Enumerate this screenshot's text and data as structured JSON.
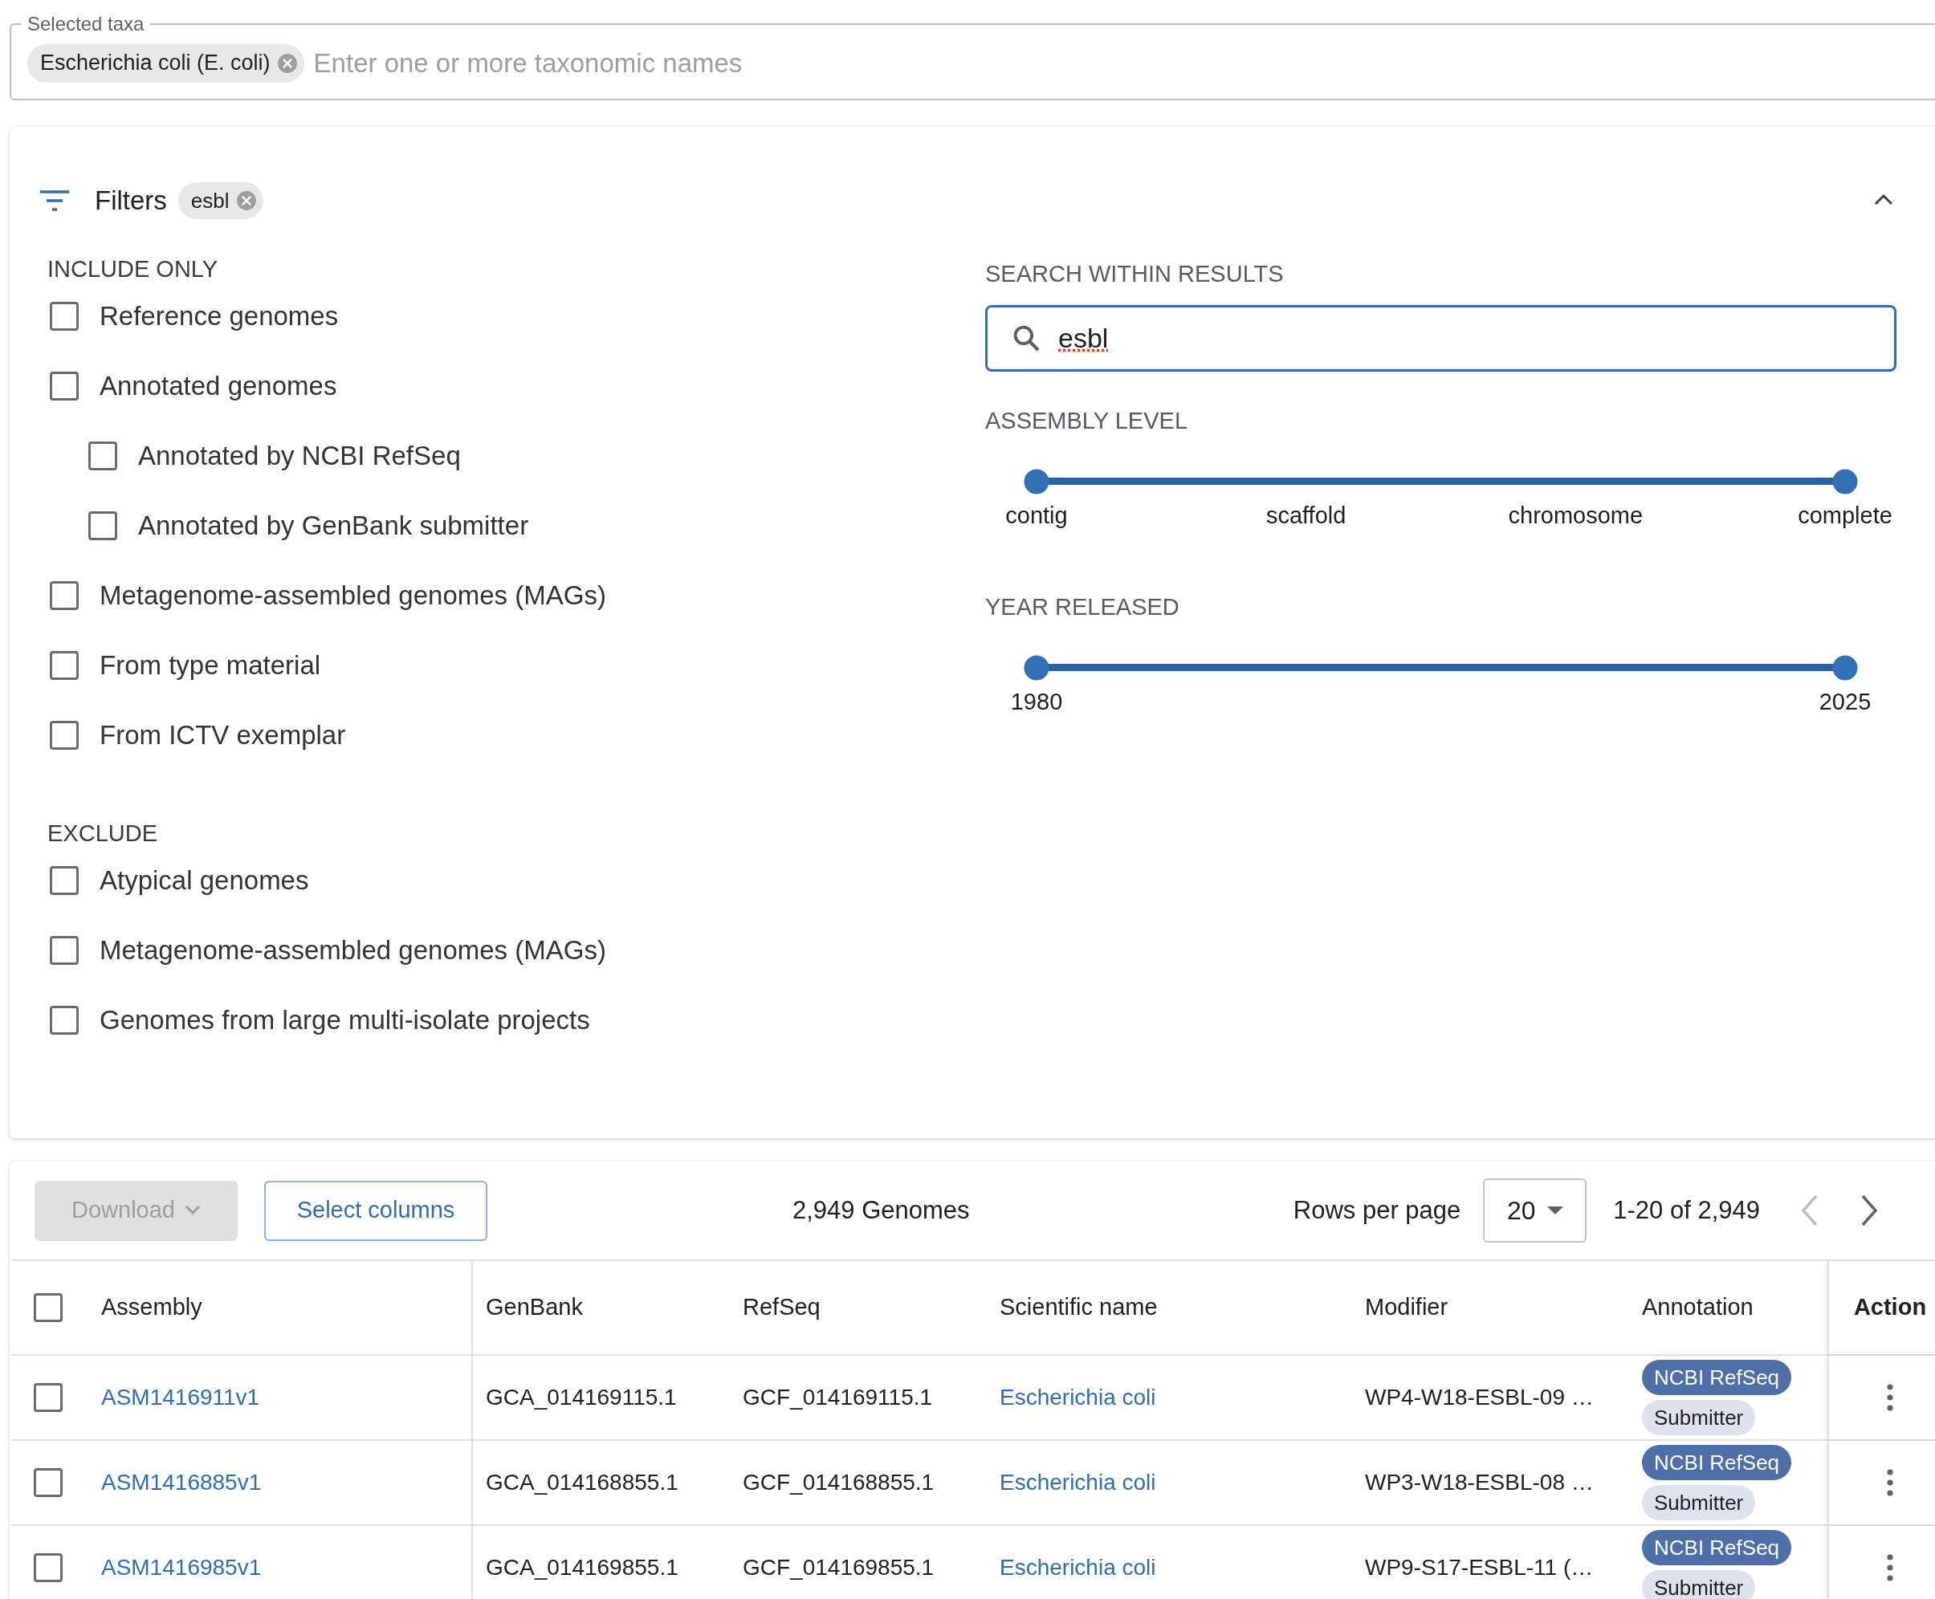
{
  "selected_taxa": {
    "legend": "Selected taxa",
    "chips": [
      {
        "label": "Escherichia coli (E. coli)"
      }
    ],
    "placeholder": "Enter one or more taxonomic names"
  },
  "filters": {
    "title": "Filters",
    "expanded": true,
    "chips": [
      {
        "label": "esbl"
      }
    ],
    "include": {
      "heading": "INCLUDE ONLY",
      "options": [
        {
          "label": "Reference genomes",
          "checked": false
        },
        {
          "label": "Annotated genomes",
          "checked": false,
          "children": [
            {
              "label": "Annotated by NCBI RefSeq",
              "checked": false
            },
            {
              "label": "Annotated by GenBank submitter",
              "checked": false
            }
          ]
        },
        {
          "label": "Metagenome-assembled genomes (MAGs)",
          "checked": false
        },
        {
          "label": "From type material",
          "checked": false
        },
        {
          "label": "From ICTV exemplar",
          "checked": false
        }
      ]
    },
    "exclude": {
      "heading": "EXCLUDE",
      "options": [
        {
          "label": "Atypical genomes",
          "checked": false
        },
        {
          "label": "Metagenome-assembled genomes (MAGs)",
          "checked": false
        },
        {
          "label": "Genomes from large multi-isolate projects",
          "checked": false
        }
      ]
    },
    "search": {
      "heading": "SEARCH WITHIN RESULTS",
      "value": "esbl"
    },
    "sliders": [
      {
        "heading": "ASSEMBLY LEVEL",
        "stops": [
          "contig",
          "scaffold",
          "chromosome",
          "complete"
        ],
        "thumbs": [
          {
            "level": 0
          },
          {
            "level": 1
          }
        ]
      },
      {
        "heading": "YEAR RELEASED",
        "stops": [
          "1980",
          "2025"
        ],
        "thumbs": [
          {
            "level": 0
          },
          {
            "level": 1
          }
        ]
      }
    ]
  },
  "results": {
    "toolbar": {
      "download": {
        "label": "Download",
        "disabled": true
      },
      "select_columns": "Select columns",
      "count": "2,949 Genomes",
      "rows_per_page_label": "Rows per page",
      "rows_per_page": "20",
      "range": "1-20 of 2,949",
      "prev": {
        "disabled": true
      },
      "next": {
        "disabled": false
      }
    },
    "table": {
      "all_checked": false,
      "columns": [
        "Assembly",
        "GenBank",
        "RefSeq",
        "Scientific name",
        "Modifier",
        "Annotation",
        "Action"
      ],
      "rows": [
        {
          "checked": false,
          "assembly": "ASM1416911v1",
          "genbank": "GCA_014169115.1",
          "refseq": "GCF_014169115.1",
          "scientific_name": "Escherichia coli",
          "modifier": "WP4-W18-ESBL-09 …",
          "annotations": [
            {
              "label": "NCBI RefSeq",
              "kind": "refseq"
            },
            {
              "label": "Submitter",
              "kind": "submitter"
            }
          ]
        },
        {
          "checked": false,
          "assembly": "ASM1416885v1",
          "genbank": "GCA_014168855.1",
          "refseq": "GCF_014168855.1",
          "scientific_name": "Escherichia coli",
          "modifier": "WP3-W18-ESBL-08 …",
          "annotations": [
            {
              "label": "NCBI RefSeq",
              "kind": "refseq"
            },
            {
              "label": "Submitter",
              "kind": "submitter"
            }
          ]
        },
        {
          "checked": false,
          "assembly": "ASM1416985v1",
          "genbank": "GCA_014169855.1",
          "refseq": "GCF_014169855.1",
          "scientific_name": "Escherichia coli",
          "modifier": "WP9-S17-ESBL-11 (…",
          "annotations": [
            {
              "label": "NCBI RefSeq",
              "kind": "refseq"
            },
            {
              "label": "Submitter",
              "kind": "submitter"
            }
          ]
        }
      ]
    }
  }
}
